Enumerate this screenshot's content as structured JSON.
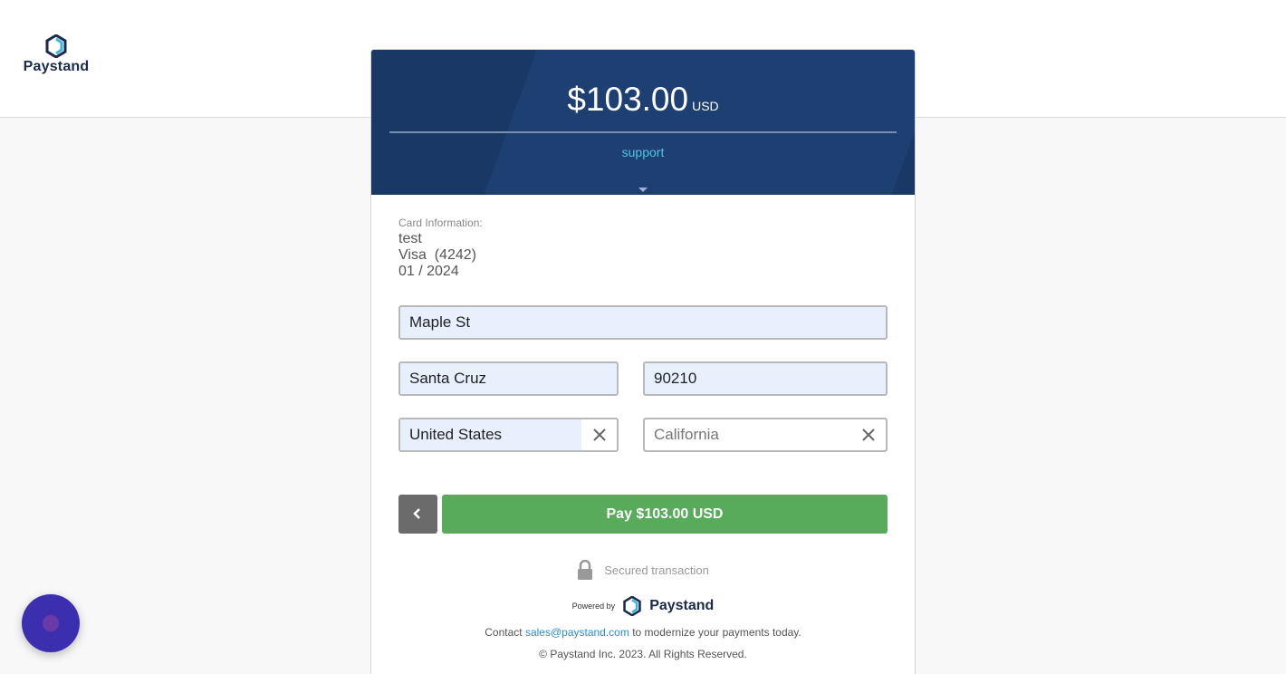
{
  "brand": {
    "name": "Paystand",
    "primary_color": "#1e3f72",
    "accent_color": "#4ec3e8"
  },
  "header": {
    "amount": "$103.00",
    "currency": "USD",
    "support_link": "support"
  },
  "card_info": {
    "title": "Card Information:",
    "name": "test",
    "card": "Visa  (4242)",
    "expiry": "01 / 2024"
  },
  "form": {
    "street": "Maple St",
    "city": "Santa Cruz",
    "zip": "90210",
    "country": "United States",
    "state_placeholder": "California"
  },
  "actions": {
    "pay_label": "Pay $103.00 USD",
    "pay_color": "#57ab5a"
  },
  "footer": {
    "secured": "Secured transaction",
    "powered_by": "Powered by",
    "powered_brand": "Paystand",
    "contact_prefix": "Contact",
    "contact_email": "sales@paystand.com",
    "contact_suffix": "to modernize your payments today.",
    "copyright": "© Paystand Inc. 2023. All Rights Reserved."
  },
  "icons": [
    "paystand-logo-icon",
    "chevron-down-icon",
    "close-icon",
    "chevron-left-icon",
    "lock-icon",
    "chat-icon"
  ]
}
